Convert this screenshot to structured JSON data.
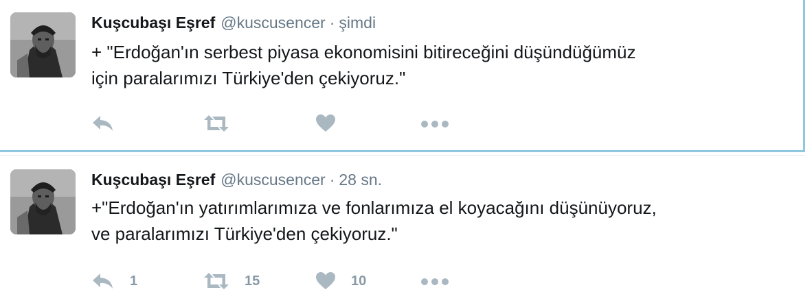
{
  "tweets": [
    {
      "fullname": "Kuşcubaşı Eşref",
      "screen_name": "@kuscusencer",
      "separator": "·",
      "time": "şimdi",
      "text_lines": [
        "+ \"Erdoğan'ın serbest piyasa ekonomisini bitireceğini düşündüğümüz",
        "için paralarımızı Türkiye'den çekiyoruz.\""
      ],
      "actions": {
        "reply_icon": "reply-arrow-icon",
        "retweet_icon": "retweet-icon",
        "like_icon": "heart-icon",
        "more_icon": "more-dots-icon",
        "reply_count": "",
        "retweet_count": "",
        "like_count": ""
      }
    },
    {
      "fullname": "Kuşcubaşı Eşref",
      "screen_name": "@kuscusencer",
      "separator": "·",
      "time": "28 sn.",
      "text_lines": [
        "+\"Erdoğan'ın yatırımlarımıza ve fonlarımıza el koyacağını düşünüyoruz,",
        "ve paralarımızı Türkiye'den çekiyoruz.\""
      ],
      "actions": {
        "reply_icon": "reply-arrow-icon",
        "retweet_icon": "retweet-icon",
        "like_icon": "heart-icon",
        "more_icon": "more-dots-icon",
        "reply_count": "1",
        "retweet_count": "15",
        "like_count": "10"
      }
    }
  ],
  "colors": {
    "name": "#14171a",
    "meta": "#657786",
    "icon": "#aab8c2",
    "count": "#8899a6",
    "focus_border": "#8ec7df"
  }
}
